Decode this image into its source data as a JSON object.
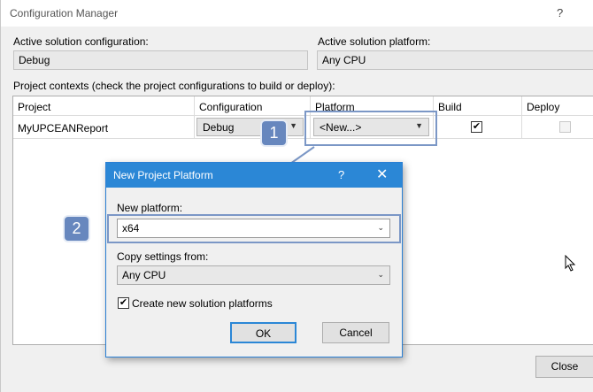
{
  "window": {
    "title": "Configuration Manager",
    "help_glyph": "?"
  },
  "solution_config": {
    "label": "Active solution configuration:",
    "value": "Debug"
  },
  "solution_platform": {
    "label": "Active solution platform:",
    "value": "Any CPU"
  },
  "project_contexts": {
    "label": "Project contexts (check the project configurations to build or deploy):",
    "columns": [
      "Project",
      "Configuration",
      "Platform",
      "Build",
      "Deploy"
    ],
    "rows": [
      {
        "project": "MyUPCEANReport",
        "configuration": "Debug",
        "platform": "<New...>",
        "build": true,
        "deploy": false
      }
    ]
  },
  "callouts": [
    "1",
    "2"
  ],
  "dialog": {
    "title": "New Project Platform",
    "help_glyph": "?",
    "close_glyph": "✕",
    "new_platform_label": "New platform:",
    "new_platform_value": "x64",
    "copy_from_label": "Copy settings from:",
    "copy_from_value": "Any CPU",
    "create_solution_platforms_label": "Create new solution platforms",
    "create_solution_platforms_checked": true,
    "ok_label": "OK",
    "cancel_label": "Cancel"
  },
  "close_label": "Close",
  "colors": {
    "dialog_title_bg": "#2b87d6",
    "callout_bg": "#6787be",
    "highlight_border": "#7b97c6"
  },
  "icons": {
    "dropdown": "chevron-down-icon",
    "checkmark": "checkmark-icon",
    "cursor": "mouse-pointer-icon"
  }
}
